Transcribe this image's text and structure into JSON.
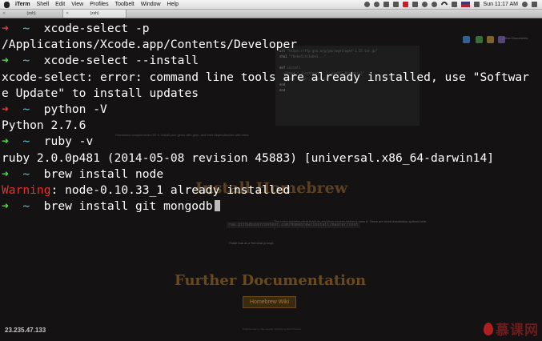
{
  "menubar": {
    "app": "iTerm",
    "items": [
      "Shell",
      "Edit",
      "View",
      "Profiles",
      "Toolbelt",
      "Window",
      "Help"
    ],
    "clock": "Sun 11:17 AM"
  },
  "tabs": [
    {
      "label": "(zsh)",
      "active": false
    },
    {
      "label": "(zsh)",
      "active": true
    }
  ],
  "terminal": {
    "lines": [
      {
        "arrow": "➜",
        "arrow_color": "red",
        "tilde": "~",
        "cmd": "xcode-select -p"
      },
      {
        "output": "/Applications/Xcode.app/Contents/Developer"
      },
      {
        "arrow": "➜",
        "arrow_color": "green",
        "tilde": "~",
        "cmd": "xcode-select --install"
      },
      {
        "output": "xcode-select: error: command line tools are already installed, use \"Softwar"
      },
      {
        "output": "e Update\" to install updates"
      },
      {
        "arrow": "➜",
        "arrow_color": "red",
        "tilde": "~",
        "cmd": "python -V"
      },
      {
        "output": "Python 2.7.6"
      },
      {
        "arrow": "➜",
        "arrow_color": "green",
        "tilde": "~",
        "cmd": "ruby -v"
      },
      {
        "output": "ruby 2.0.0p481 (2014-05-08 revision 45883) [universal.x86_64-darwin14]"
      },
      {
        "arrow": "➜",
        "arrow_color": "green",
        "tilde": "~",
        "cmd": "brew install node"
      },
      {
        "warning": "Warning",
        "output": ": node-0.10.33_1 already installed"
      },
      {
        "arrow": "➜",
        "arrow_color": "green",
        "tilde": "~",
        "cmd": "brew install git mongodb"
      }
    ]
  },
  "background": {
    "install_heading": "Install Homebrew",
    "url_fragment": "raw.githubusercontent.com/Homebrew/install/master/inst",
    "paste_text": "Paste that at a Terminal prompt.",
    "complements_text": "Homebrew complements OS X. Install your gems with gem, and their dependencies with brew.",
    "script_text": "The script explains what it will do and then pauses before it does it. There are more installation options here (needed on 10.5).",
    "further_heading": "Further Documentation",
    "wiki_button": "Homebrew Wiki",
    "footer": "Original code by Max Howell. Website by Rémi Prévost.",
    "desktop_folder": "Other Documents"
  },
  "overlay": {
    "ip": "23.235.47.133",
    "watermark": "慕课网"
  },
  "colors": {
    "red_arrow": "#e83c39",
    "green_arrow": "#3ee43c",
    "tilde": "#57c8d6",
    "warning": "#ec2f2c",
    "text": "#ffffff",
    "background": "#141212"
  }
}
